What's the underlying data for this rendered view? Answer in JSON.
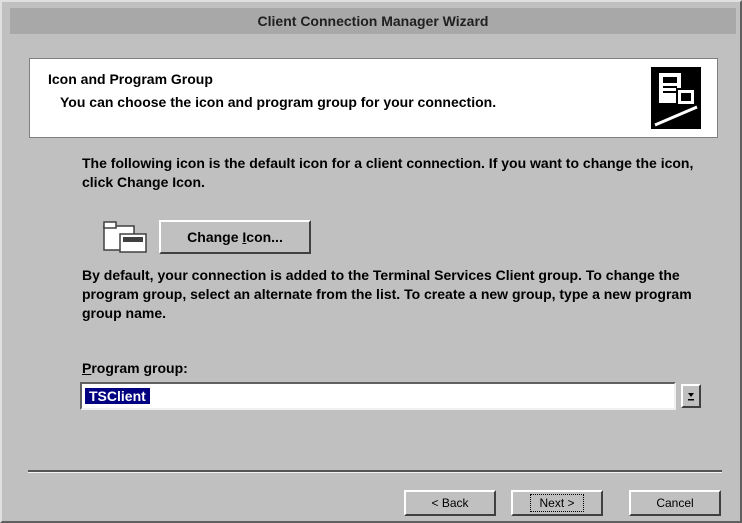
{
  "window": {
    "title": "Client Connection Manager Wizard"
  },
  "header": {
    "title": "Icon and Program Group",
    "subtitle": "You can choose the icon and program group for your connection.",
    "icon": "wizard-icon"
  },
  "body": {
    "paragraph1": "The following icon is the default icon for a client connection. If you want to change the icon, click Change Icon.",
    "connection_icon": "connection-icon",
    "change_icon_button": {
      "before": "Change ",
      "accel": "I",
      "after": "con..."
    },
    "paragraph2": "By default, your connection is added to the Terminal Services Client group. To change the program group, select an alternate from the list. To create a new group, type a new program group name.",
    "program_group_label": {
      "accel": "P",
      "after": "rogram group:"
    },
    "program_group_value": "TSClient",
    "dropdown_icon": "dropdown-arrow-icon"
  },
  "footer": {
    "back_label": "< Back",
    "next_label": "Next >",
    "cancel_label": "Cancel"
  }
}
